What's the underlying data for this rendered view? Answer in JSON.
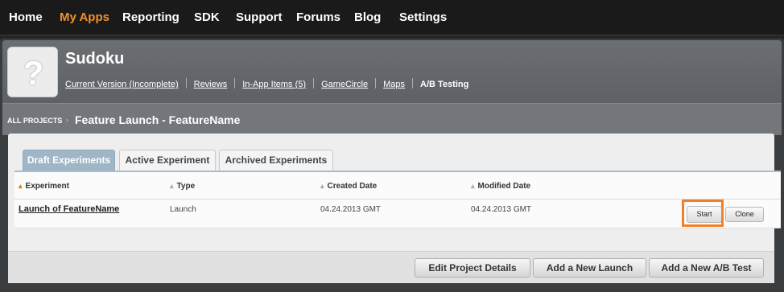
{
  "nav": {
    "items": [
      {
        "label": "Home"
      },
      {
        "label": "My Apps"
      },
      {
        "label": "Reporting"
      },
      {
        "label": "SDK"
      },
      {
        "label": "Support"
      },
      {
        "label": "Forums"
      },
      {
        "label": "Blog"
      },
      {
        "label": "Settings"
      }
    ],
    "active_color": "#f0912f"
  },
  "app": {
    "icon": "question-mark-icon",
    "icon_glyph": "?",
    "title": "Sudoku",
    "links": [
      {
        "label": "Current Version (Incomplete)"
      },
      {
        "label": "Reviews"
      },
      {
        "label": "In-App Items (5)"
      },
      {
        "label": "GameCircle"
      },
      {
        "label": "Maps"
      },
      {
        "label": "A/B Testing"
      }
    ]
  },
  "breadcrumb": {
    "root": "ALL PROJECTS",
    "arrow": "›",
    "title": "Feature Launch - FeatureName"
  },
  "tabs": [
    {
      "label": "Draft Experiments",
      "active": true
    },
    {
      "label": "Active Experiment",
      "active": false
    },
    {
      "label": "Archived Experiments",
      "active": false
    }
  ],
  "table": {
    "columns": [
      "Experiment",
      "Type",
      "Created Date",
      "Modified Date"
    ],
    "rows": [
      {
        "experiment": "Launch of FeatureName",
        "type": "Launch",
        "created": "04.24.2013 GMT",
        "modified": "04.24.2013 GMT"
      }
    ],
    "row_actions": {
      "start": "Start",
      "clone": "Clone"
    }
  },
  "footer": {
    "edit": "Edit Project Details",
    "add_launch": "Add a New Launch",
    "add_ab": "Add a New A/B Test"
  },
  "colors": {
    "accent": "#f0812a",
    "active_tab": "#9fb6c6"
  }
}
